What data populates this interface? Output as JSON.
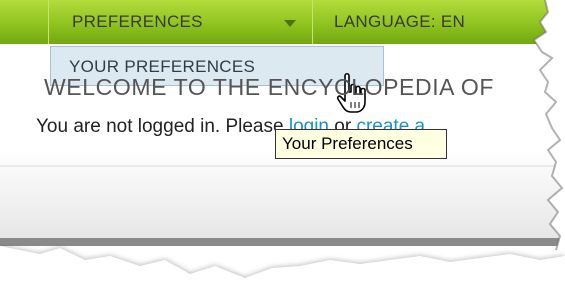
{
  "nav": {
    "preferences_label": "PREFERENCES",
    "language_label": "LANGUAGE: EN"
  },
  "dropdown": {
    "items": [
      {
        "label": "YOUR PREFERENCES"
      }
    ]
  },
  "content": {
    "welcome_text": "WELCOME TO THE ENCYCLOPEDIA OF",
    "status_prefix": "You are not logged in. Please",
    "login_link": "login",
    "or_text": "or",
    "create_link": "create a"
  },
  "tooltip": {
    "text": "Your Preferences"
  },
  "icons": {
    "dropdown_caret": "caret-down-icon",
    "cursor": "hand-pointer-icon"
  },
  "colors": {
    "nav_green": "#8fc31f",
    "dropdown_bg": "#dde9f1",
    "link_blue": "#1a8fd1",
    "tooltip_bg": "#ffffe1"
  }
}
